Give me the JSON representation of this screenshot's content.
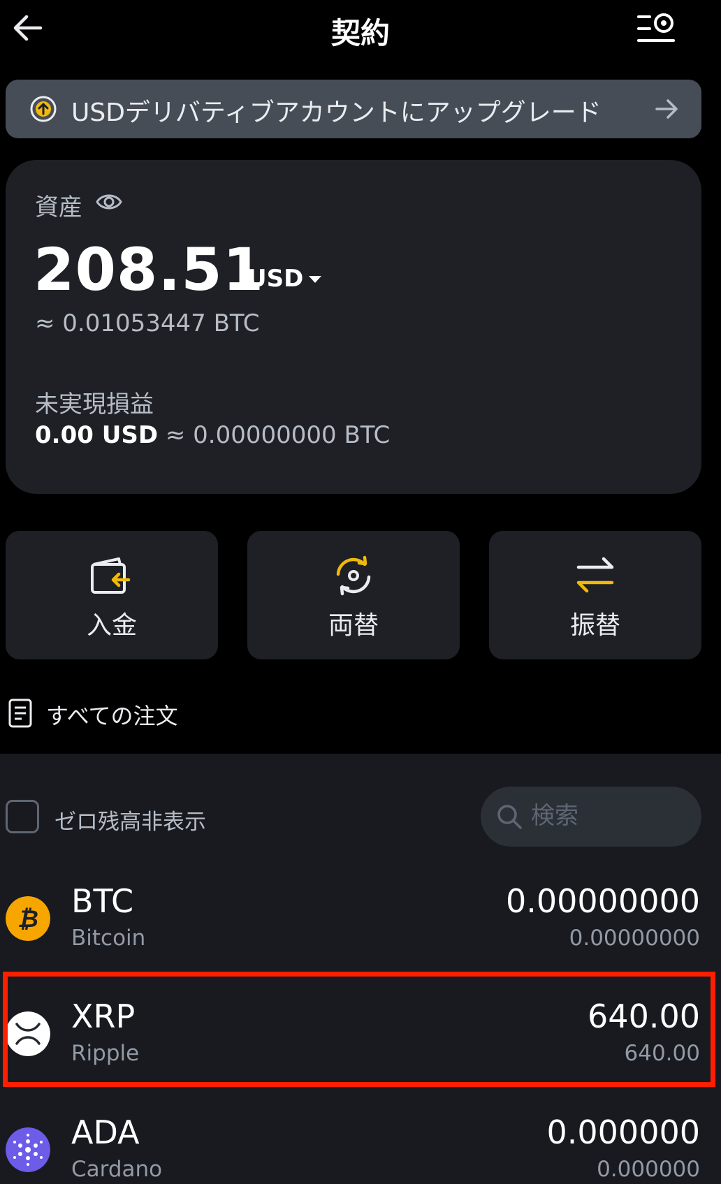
{
  "header": {
    "title": "契約",
    "back_icon": "arrow-left-icon",
    "menu_icon": "list-settings-icon"
  },
  "banner": {
    "text": "USDデリバティブアカウントにアップグレード",
    "icon": "arrow-up-circle-icon",
    "arrow_icon": "arrow-right-icon"
  },
  "asset": {
    "label": "資産",
    "value": "208.51",
    "currency": "USD",
    "approx": "≈  0.01053447 BTC",
    "pnl_label": "未実現損益",
    "pnl_usd": "0.00 USD",
    "pnl_btc": " ≈ 0.00000000 BTC"
  },
  "actions": [
    {
      "label": "入金",
      "icon": "wallet-deposit-icon"
    },
    {
      "label": "両替",
      "icon": "convert-icon"
    },
    {
      "label": "振替",
      "icon": "transfer-arrows-icon"
    }
  ],
  "orders": {
    "label": "すべての注文",
    "icon": "document-icon"
  },
  "filter": {
    "hide_zero_label": "ゼロ残高非表示",
    "hide_zero_checked": false,
    "search_placeholder": "検索"
  },
  "coins": [
    {
      "symbol": "BTC",
      "name": "Bitcoin",
      "amount": "0.00000000",
      "sub": "0.00000000",
      "icon": "bitcoin-icon",
      "color": "#F7A600"
    },
    {
      "symbol": "XRP",
      "name": "Ripple",
      "amount": "640.00",
      "sub": "640.00",
      "icon": "xrp-icon",
      "color": "#FFFFFF"
    },
    {
      "symbol": "ADA",
      "name": "Cardano",
      "amount": "0.000000",
      "sub": "0.000000",
      "icon": "cardano-icon",
      "color": "#6C5CE7"
    }
  ],
  "colors": {
    "accent": "#F0B90B",
    "highlight": "#FF1F00",
    "background": "#000000",
    "card": "#1E2026"
  }
}
